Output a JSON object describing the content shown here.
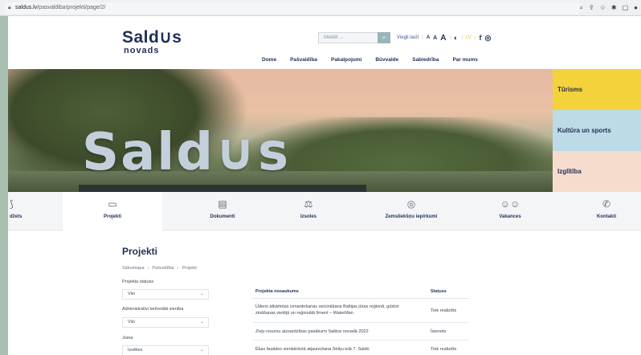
{
  "browser": {
    "url_host": "saldus.lv",
    "url_path": "/pasvaldiba/projekti/page/2/",
    "icons": [
      "zoom-icon",
      "share-icon",
      "star-icon",
      "extensions-icon",
      "window-icon",
      "profile-icon"
    ]
  },
  "header": {
    "logo_main": "Sald∪s",
    "logo_sub": "novads",
    "search_placeholder": "Meklēt ...",
    "tools": {
      "easy_read": "Viegli lasīt",
      "font_small": "A",
      "font_medium": "A",
      "font_large": "A",
      "contrast": "◐",
      "sign_language": "LV",
      "facebook": "f",
      "instagram": "◎"
    },
    "nav": [
      "Dome",
      "Pašvaldība",
      "Pakalpojumi",
      "Būvvalde",
      "Sabiedrība",
      "Par mums"
    ]
  },
  "hero": {
    "word": "Sald∪s"
  },
  "side_menu": [
    {
      "label": "Tūrisms",
      "color": "#f4d23c"
    },
    {
      "label": "Kultūra un sports",
      "color": "#bcdbe6"
    },
    {
      "label": "Izglītība",
      "color": "#f6dccd"
    }
  ],
  "quick_nav": [
    {
      "label": "džets",
      "icon": "budget-icon"
    },
    {
      "label": "Projekti",
      "icon": "projects-icon",
      "active": true
    },
    {
      "label": "Dokumenti",
      "icon": "documents-icon"
    },
    {
      "label": "Izsoles",
      "icon": "auction-icon"
    },
    {
      "label": "Zemsliekšņu iepirkumi",
      "icon": "procurement-icon"
    },
    {
      "label": "Vakances",
      "icon": "vacancies-icon"
    },
    {
      "label": "Kontakti",
      "icon": "phone-icon"
    }
  ],
  "content": {
    "title": "Projekti",
    "breadcrumb": [
      "Sākumlapa",
      "Pašvaldība",
      "Projekti"
    ],
    "filters": [
      {
        "label": "Projekta statuss",
        "value": "Visi"
      },
      {
        "label": "Administratīvi teritoriālā vienība",
        "value": "Visi"
      },
      {
        "label": "Joma",
        "value": "Izvēlies"
      }
    ],
    "table": {
      "headers": [
        "Projekta nosaukums",
        "Statuss"
      ],
      "rows": [
        {
          "name": "Ūdens atkārtotas izmantošanas veicināšana Baltijas jūras reģionā, gūstot zināšanas vietējā un reģionālā līmenī – WaterMan",
          "status": "Tiek realizēts"
        },
        {
          "name": "Zivju resursu aizsardzības pasākumi Saldus novadā 2022",
          "status": "Īstenots"
        },
        {
          "name": "Ēkas fasādes vienkāršotā atjaunošana Striķu ielā 7, Saldū",
          "status": "Tiek realizēts"
        }
      ]
    }
  }
}
